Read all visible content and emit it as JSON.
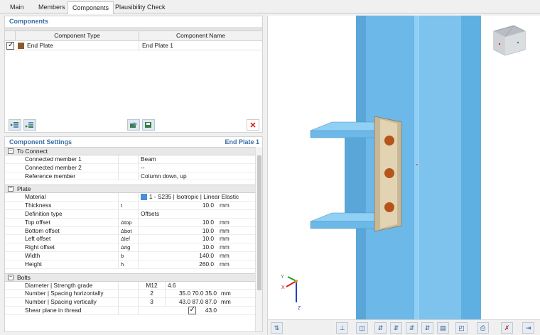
{
  "tabs": [
    {
      "label": "Main"
    },
    {
      "label": "Members"
    },
    {
      "label": "Components"
    },
    {
      "label": "Plausibility Check"
    }
  ],
  "components_panel": {
    "title": "Components",
    "headers": {
      "type": "Component Type",
      "name": "Component Name"
    },
    "rows": [
      {
        "checked": true,
        "type": "End Plate",
        "name": "End Plate 1",
        "color": "#8b5a2b"
      }
    ]
  },
  "settings_panel": {
    "title": "Component Settings",
    "component": "End Plate 1",
    "to_connect": {
      "label": "To Connect",
      "rows": [
        {
          "name": "Connected member 1",
          "value": "Beam"
        },
        {
          "name": "Connected member 2",
          "value": "--"
        },
        {
          "name": "Reference member",
          "value": "Column down, up"
        }
      ]
    },
    "plate": {
      "label": "Plate",
      "material": {
        "name": "Material",
        "value": "1 - S235 | Isotropic | Linear Elastic",
        "color": "#4a90d9"
      },
      "rows": [
        {
          "name": "Thickness",
          "sym": "t",
          "value": "10.0",
          "unit": "mm"
        },
        {
          "name": "Definition type",
          "sym": "",
          "value": "Offsets",
          "unit": ""
        },
        {
          "name": "Top offset",
          "sym": "Δtop",
          "value": "10.0",
          "unit": "mm"
        },
        {
          "name": "Bottom offset",
          "sym": "Δbot",
          "value": "10.0",
          "unit": "mm"
        },
        {
          "name": "Left offset",
          "sym": "Δlef",
          "value": "10.0",
          "unit": "mm"
        },
        {
          "name": "Right offset",
          "sym": "Δrig",
          "value": "10.0",
          "unit": "mm"
        },
        {
          "name": "Width",
          "sym": "b",
          "value": "140.0",
          "unit": "mm"
        },
        {
          "name": "Height",
          "sym": "h",
          "value": "260.0",
          "unit": "mm"
        }
      ]
    },
    "bolts": {
      "label": "Bolts",
      "rows": [
        {
          "name": "Diameter | Strength grade",
          "a": "M12",
          "b": "4.6",
          "unit": ""
        },
        {
          "name": "Number | Spacing horizontally",
          "a": "2",
          "b": "35.0 70.0 35.0",
          "unit": "mm"
        },
        {
          "name": "Number | Spacing vertically",
          "a": "3",
          "b": "43.0 87.0 87.0 43.0",
          "unit": "mm"
        },
        {
          "name": "Shear plane in thread",
          "a": "",
          "b": "",
          "unit": "",
          "checkbox": true
        }
      ]
    }
  },
  "view": {
    "axes": {
      "x": "X",
      "y": "Y",
      "z": "Z"
    }
  }
}
